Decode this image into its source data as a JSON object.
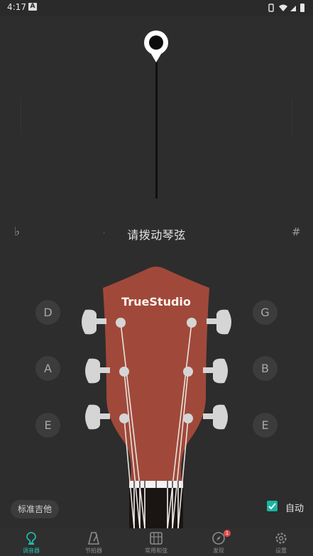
{
  "status_bar": {
    "time": "4:17",
    "notif_letter": "A"
  },
  "tuner": {
    "flat_symbol": "♭",
    "sharp_symbol": "#",
    "dot": "·",
    "prompt": "请拨动琴弦"
  },
  "headstock": {
    "brand": "TrueStudio",
    "wood_color": "#a0493a",
    "left_notes": [
      "D",
      "A",
      "E"
    ],
    "right_notes": [
      "G",
      "B",
      "E"
    ]
  },
  "controls": {
    "tuning_button": "标准吉他",
    "auto_label": "自动",
    "auto_checked": true
  },
  "nav": {
    "items": [
      {
        "label": "调音器",
        "icon": "tuner-icon",
        "active": true
      },
      {
        "label": "节拍器",
        "icon": "metronome-icon",
        "active": false
      },
      {
        "label": "常用和弦",
        "icon": "chord-icon",
        "active": false
      },
      {
        "label": "发现",
        "icon": "compass-icon",
        "active": false,
        "badge": "1"
      },
      {
        "label": "设置",
        "icon": "gear-icon",
        "active": false
      }
    ]
  },
  "colors": {
    "accent": "#1fc4b0",
    "background": "#2d2d2d",
    "badge": "#e24a4a"
  }
}
